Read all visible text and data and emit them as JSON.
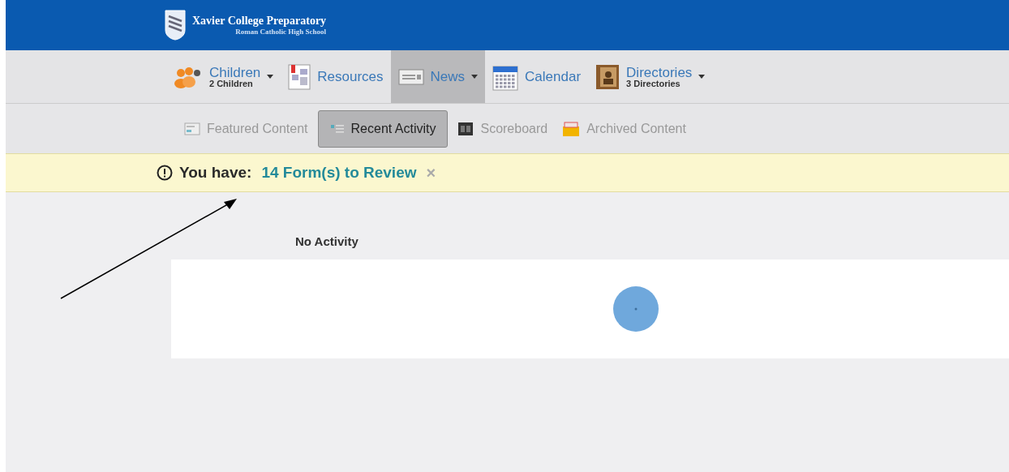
{
  "header": {
    "title": "Xavier College Preparatory",
    "subtitle": "Roman Catholic High School"
  },
  "nav": [
    {
      "kind": "people",
      "label": "Children",
      "sublabel": "2 Children",
      "dropdown": true,
      "selected": false
    },
    {
      "kind": "resources",
      "label": "Resources",
      "dropdown": false,
      "selected": false
    },
    {
      "kind": "news",
      "label": "News",
      "dropdown": true,
      "selected": true
    },
    {
      "kind": "calendar",
      "label": "Calendar",
      "dropdown": false,
      "selected": false
    },
    {
      "kind": "directory",
      "label": "Directories",
      "sublabel": "3 Directories",
      "dropdown": true,
      "selected": false
    }
  ],
  "subtabs": [
    {
      "kind": "featured",
      "label": "Featured Content",
      "selected": false
    },
    {
      "kind": "list",
      "label": "Recent Activity",
      "selected": true
    },
    {
      "kind": "board",
      "label": "Scoreboard",
      "selected": false
    },
    {
      "kind": "archive",
      "label": "Archived Content",
      "selected": false
    }
  ],
  "alert": {
    "prefix": "You have:",
    "link": "14 Form(s) to Review",
    "close": "×"
  },
  "activity": {
    "heading": "No Activity",
    "loading": true
  }
}
